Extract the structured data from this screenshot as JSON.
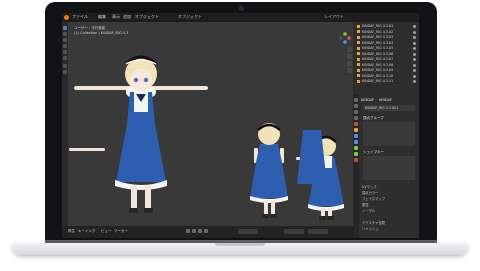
{
  "blender": {
    "menu": [
      "ファイル",
      "編集",
      "表示",
      "追加",
      "オブジェクト"
    ],
    "mode": "オブジェクト",
    "workspace": "レイアウト",
    "viewport_info": [
      "ユーザー・平行投影",
      "(1) Collection | KINDAF_RIG 4.3"
    ],
    "outliner_rows": [
      "KINDAF_RIG 4.3.01",
      "KINDAF_RIG 4.3.02",
      "KINDAF_RIG 4.3.03",
      "KINDAF_RIG 4.3.04",
      "KINDAF_RIG 4.3.05",
      "KINDAF_RIG 4.3.06",
      "KINDAF_RIG 4.3.07",
      "KINDAF_RIG 4.3.08",
      "KINDAF_RIG 4.3.09",
      "KINDAF_RIG 4.3.10",
      "KINDAF_RIG 4.3.11"
    ],
    "props_header": [
      "KINDAF",
      "KINDAF"
    ],
    "props_object": "KINDAF_RIG 4.3 001",
    "props_sections": [
      "頂点グループ",
      "シェイプキー",
      "UVマップ",
      "頂点カラー",
      "フェイスマップ",
      "属性",
      "ノーマル",
      "テクスチャ空間",
      "リメッシュ"
    ],
    "timeline_menu": [
      "再生",
      "キーイング",
      "ビュー",
      "マーカー"
    ],
    "colors": {
      "accent": "#e8a23a",
      "x_axis": "#e0505a",
      "y_axis": "#7ec93c",
      "z_axis": "#4f8fe8",
      "dress": "#2d5fb0"
    }
  }
}
